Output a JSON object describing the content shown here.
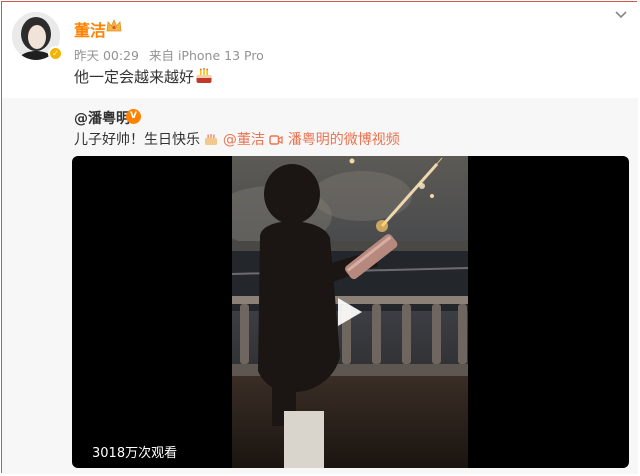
{
  "post": {
    "username": "董洁",
    "time": "昨天 00:29",
    "source": "来自 iPhone 13 Pro",
    "text": "他一定会越来越好",
    "icons": {
      "avatar_badge": "verified-badge",
      "crown": "crown-icon",
      "cake": "cake-icon",
      "chevron": "chevron-down-icon"
    },
    "colors": {
      "username": "#ff8200",
      "meta": "#939393"
    }
  },
  "repost": {
    "username": "@潘粤明",
    "badge": "V",
    "text_prefix": "儿子好帅！生日快乐",
    "mention": "@董洁",
    "video_link": "潘粤明的微博视频",
    "icons": {
      "cake": "cake-icon",
      "video": "video-icon",
      "play": "play-icon"
    },
    "colors": {
      "link": "#eb7350",
      "background": "#f7f7f7"
    }
  },
  "video": {
    "views": "3018万次观看"
  }
}
